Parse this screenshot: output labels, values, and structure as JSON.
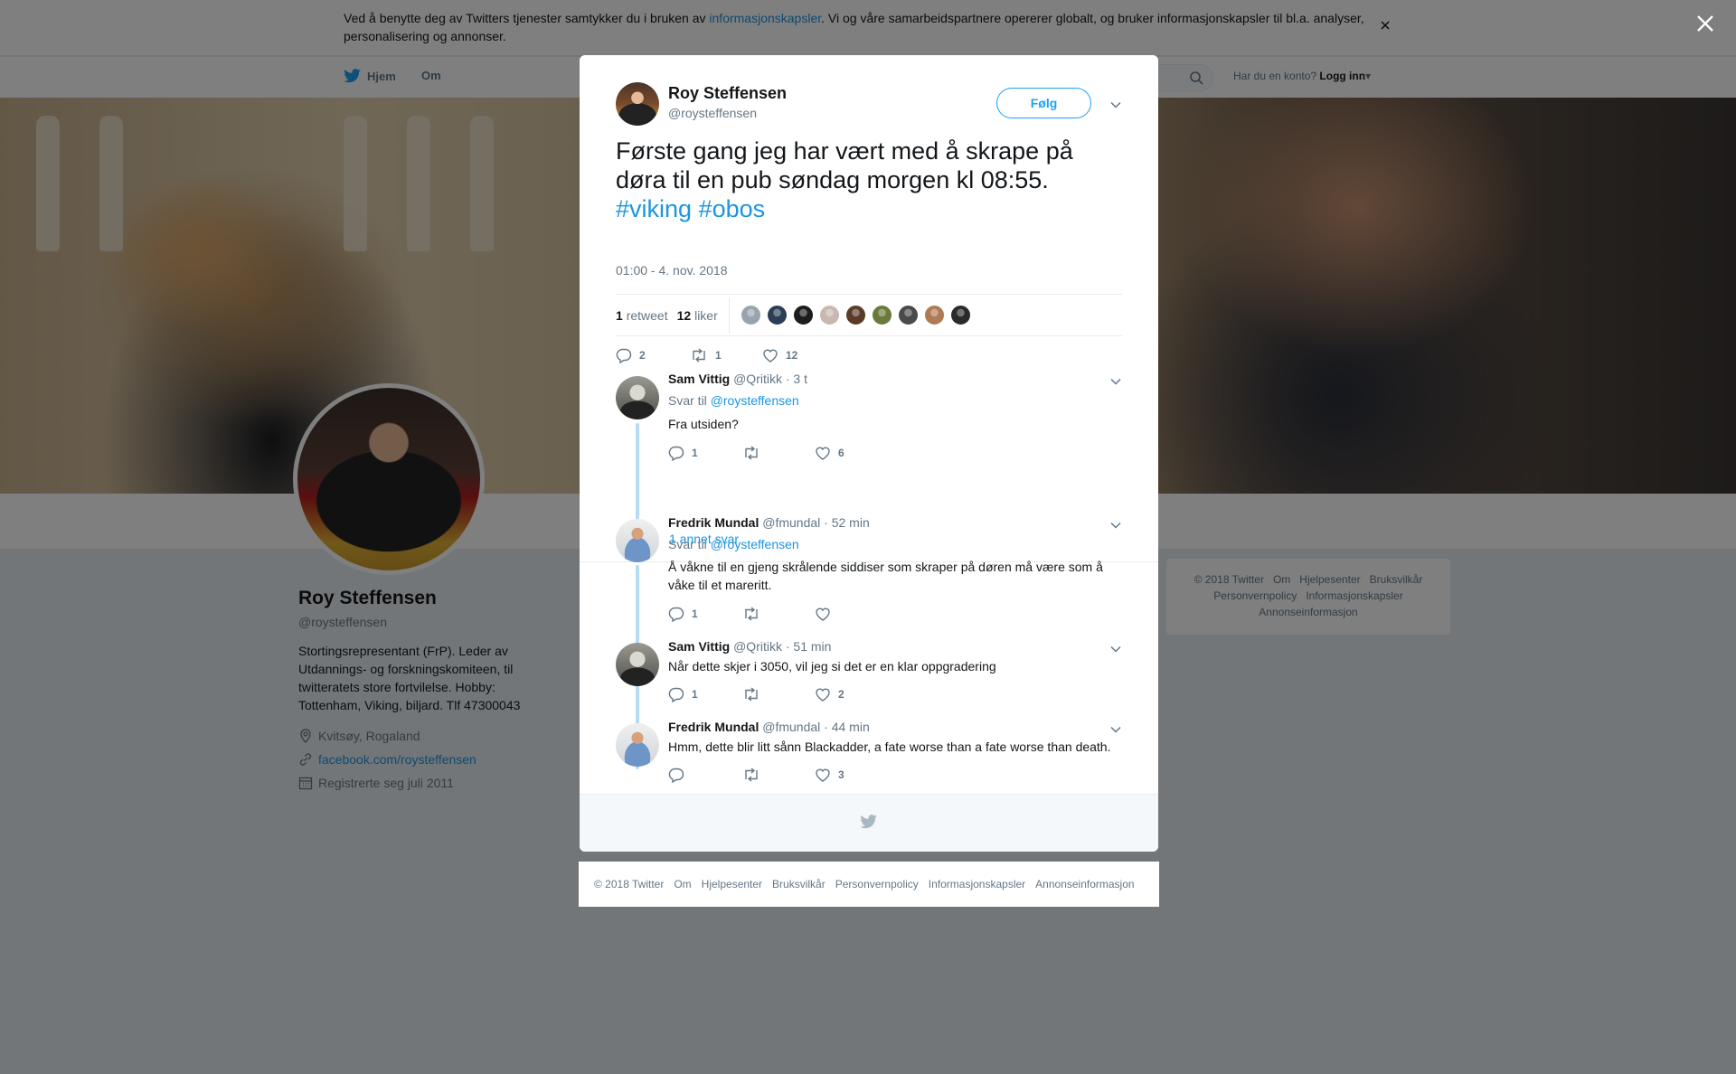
{
  "cookie_bar": {
    "text_before": "Ved å benytte deg av Twitters tjenester samtykker du i bruken av ",
    "link": "informasjonskapsler",
    "text_after": ". Vi og våre samarbeidspartnere opererer globalt, og bruker informasjonskapsler til bl.a. analyser, personalisering og annonser."
  },
  "nav": {
    "home": "Hjem",
    "about": "Om",
    "login_prompt": "Har du en konto?",
    "login": "Logg inn"
  },
  "profile": {
    "name": "Roy Steffensen",
    "handle": "@roysteffensen",
    "bio": "Stortingsrepresentant (FrP). Leder av Utdannings- og forskningskomiteen, til twitteratets store fortvilelse. Hobby: Tottenham, Viking, biljard. Tlf 47300043",
    "location": "Kvitsøy, Rogaland",
    "website": "facebook.com/roysteffensen",
    "joined": "Registrerte seg juli 2011"
  },
  "right_footer": [
    "© 2018 Twitter",
    "Om",
    "Hjelpesenter",
    "Bruksvilkår",
    "Personvernpolicy",
    "Informasjonskapsler",
    "Annonseinformasjon"
  ],
  "tweet": {
    "name": "Roy Steffensen",
    "handle": "@roysteffensen",
    "follow": "Følg",
    "text": "Første gang jeg har vært med å skrape på døra til en pub søndag morgen kl 08:55.",
    "hashtags": [
      "#viking",
      "#obos"
    ],
    "time": "01:00 - 4. nov. 2018",
    "retweets_count": "1",
    "retweets_label": "retweet",
    "likes_count": "12",
    "likes_label": "liker",
    "likers": [
      "#9aa3ad",
      "#2c3e55",
      "#1d1d1d",
      "#c8b8b0",
      "#5b3a2a",
      "#6a7a3a",
      "#4a4a4a",
      "#b07a55",
      "#2a2a2a"
    ],
    "actions": {
      "replies": "2",
      "retweets": "1",
      "likes": "12"
    }
  },
  "replies": [
    {
      "name": "Sam Vittig",
      "handle": "@Qritikk",
      "time": "· 3 t",
      "reply_to_label": "Svar til",
      "reply_to": "@roysteffensen",
      "text": "Fra utsiden?",
      "replies": "1",
      "retweets": "",
      "likes": "6",
      "more": "1 annet svar"
    },
    {
      "name": "Fredrik Mundal",
      "handle": "@fmundal",
      "time": "· 52 min",
      "reply_to_label": "Svar til",
      "reply_to": "@roysteffensen",
      "text": "Å våkne til en gjeng skrålende siddiser som skraper på døren må være som å våke til et mareritt.",
      "replies": "1",
      "retweets": "",
      "likes": ""
    },
    {
      "name": "Sam Vittig",
      "handle": "@Qritikk",
      "time": "· 51 min",
      "text": "Når dette skjer i 3050, vil jeg si det er en klar oppgradering",
      "replies": "1",
      "retweets": "",
      "likes": "2"
    },
    {
      "name": "Fredrik Mundal",
      "handle": "@fmundal",
      "time": "· 44 min",
      "text": "Hmm, dette blir litt sånn Blackadder, a fate worse than a fate worse than death.",
      "replies": "",
      "retweets": "",
      "likes": "3"
    }
  ],
  "modal_footer": [
    "© 2018 Twitter",
    "Om",
    "Hjelpesenter",
    "Bruksvilkår",
    "Personvernpolicy",
    "Informasjonskapsler",
    "Annonseinformasjon"
  ],
  "colors": {
    "accent": "#1da1f2",
    "link": "#1b95e0",
    "thread": "#b6dbf3"
  }
}
